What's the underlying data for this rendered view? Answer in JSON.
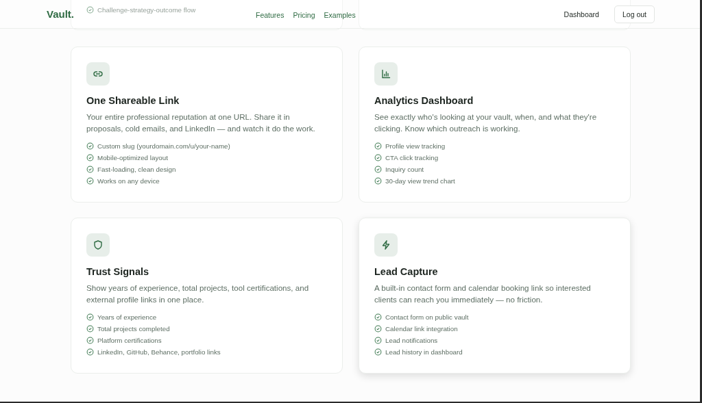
{
  "header": {
    "logo": "Vault.",
    "nav": [
      "Features",
      "Pricing",
      "Examples"
    ],
    "dashboard": "Dashboard",
    "logout": "Log out"
  },
  "cut_cards": [
    {
      "kind": "cut",
      "items": [
        "Challenge-strategy-outcome flow"
      ]
    },
    {
      "kind": "cut"
    }
  ],
  "cards": [
    {
      "title": "One Shareable Link",
      "description": "Your entire professional reputation at one URL. Share it in proposals, cold emails, and LinkedIn — and watch it do the work.",
      "items": [
        "Custom slug (yourdomain.com/u/your-name)",
        "Mobile-optimized layout",
        "Fast-loading, clean design",
        "Works on any device"
      ],
      "hovered": false
    },
    {
      "title": "Analytics Dashboard",
      "description": "See exactly who's looking at your vault, when, and what they're clicking. Know which outreach is working.",
      "items": [
        "Profile view tracking",
        "CTA click tracking",
        "Inquiry count",
        "30-day view trend chart"
      ],
      "hovered": false
    },
    {
      "title": "Trust Signals",
      "description": "Show years of experience, total projects, tool certifications, and external profile links in one place.",
      "items": [
        "Years of experience",
        "Total projects completed",
        "Platform certifications",
        "LinkedIn, GitHub, Behance, portfolio links"
      ],
      "hovered": false
    },
    {
      "title": "Lead Capture",
      "description": "A built-in contact form and calendar booking link so interested clients can reach you immediately — no friction.",
      "items": [
        "Contact form on public vault",
        "Calendar link integration",
        "Lead notifications",
        "Lead history in dashboard"
      ],
      "hovered": true
    }
  ]
}
